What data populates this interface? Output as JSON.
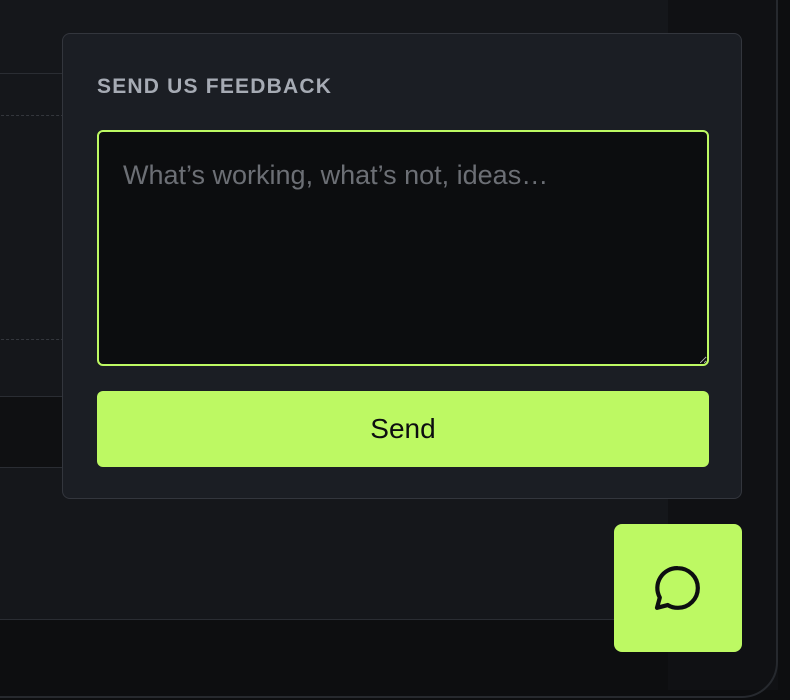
{
  "feedback": {
    "title": "SEND US FEEDBACK",
    "placeholder": "What’s working, what’s not, ideas…",
    "value": "",
    "send_label": "Send"
  },
  "chat_launcher": {
    "icon": "chat-bubble-icon"
  },
  "colors": {
    "accent": "#bdf963",
    "panel_bg": "#1b1e24",
    "input_bg": "#0c0d0f",
    "page_bg": "#0d0e10"
  }
}
